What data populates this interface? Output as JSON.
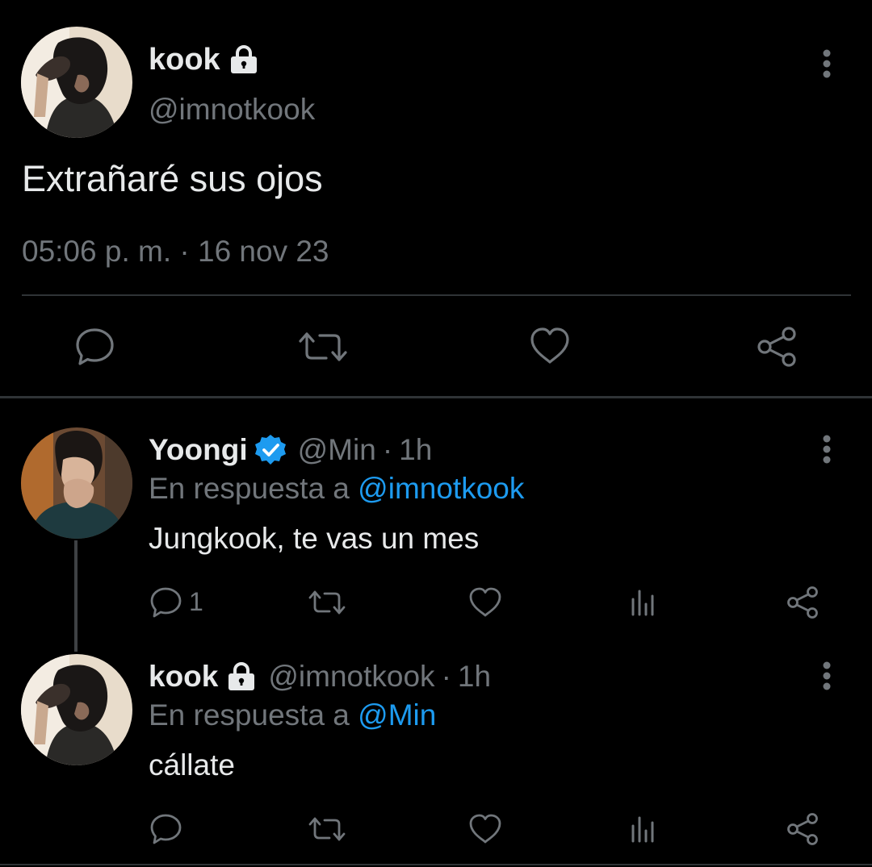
{
  "main_tweet": {
    "display_name": "kook",
    "handle": "@imnotkook",
    "protected_icon": "lock-icon",
    "text": "Extrañaré sus ojos",
    "meta": "05:06 p. m. · 16 nov 23",
    "actions": [
      "reply-icon",
      "retweet-icon",
      "like-icon",
      "share-icon"
    ]
  },
  "replies": [
    {
      "display_name": "Yoongi",
      "verified_icon": "verified-badge-icon",
      "handle": "@Min",
      "separator": "·",
      "time": "1h",
      "reply_prefix": "En respuesta a ",
      "reply_to": "@imnotkook",
      "text": "Jungkook, te vas un mes",
      "reply_count": "1"
    },
    {
      "display_name": "kook",
      "protected_icon": "lock-icon",
      "handle": "@imnotkook",
      "separator": "·",
      "time": "1h",
      "reply_prefix": "En respuesta a ",
      "reply_to": "@Min",
      "text": "cállate",
      "reply_count": ""
    }
  ],
  "colors": {
    "background": "#000000",
    "primary_text": "#e7e9ea",
    "secondary_text": "#71767b",
    "accent": "#1d9bf0",
    "divider": "#2f3336"
  }
}
